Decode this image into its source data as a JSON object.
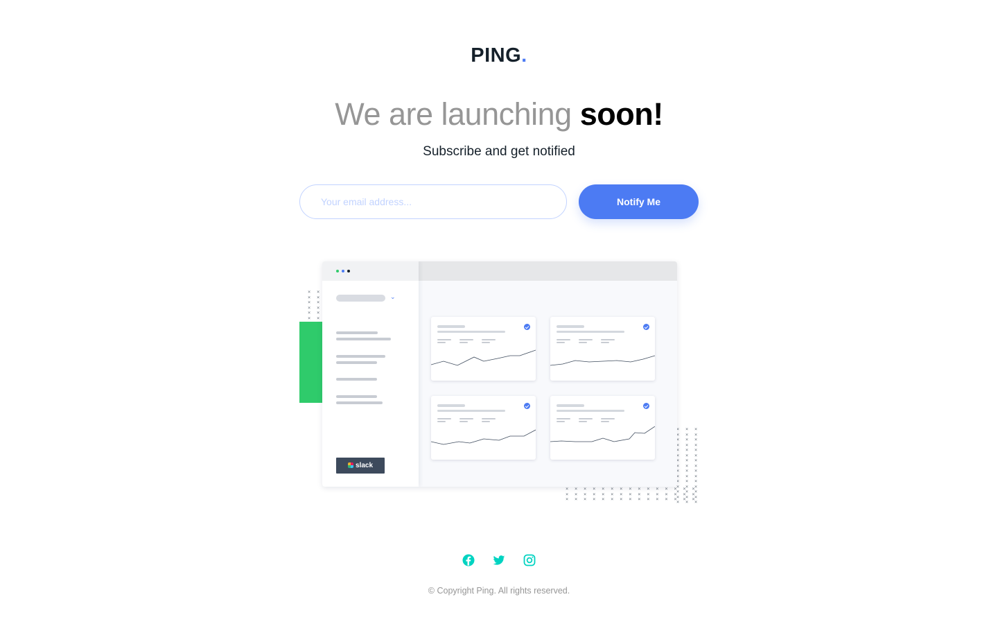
{
  "brand": {
    "name": "PING",
    "dot": "."
  },
  "hero": {
    "headline_light": "We are launching",
    "headline_bold": "soon!",
    "subline": "Subscribe and get notified"
  },
  "form": {
    "email_placeholder": "Your email address...",
    "email_value": "",
    "button_label": "Notify Me"
  },
  "illustration": {
    "badge_label": "slack",
    "window_dot_colors": [
      "#2fcb6b",
      "#4c7bf3",
      "#15202a"
    ]
  },
  "social": [
    {
      "name": "facebook-icon",
      "color": "#00d3c1"
    },
    {
      "name": "twitter-icon",
      "color": "#00d3c1"
    },
    {
      "name": "instagram-icon",
      "color": "#00d3c1"
    }
  ],
  "footer": {
    "copyright": "© Copyright Ping. All rights reserved."
  },
  "colors": {
    "accent": "#4c7bf3",
    "green": "#2fcb6b",
    "social": "#00d3c1",
    "text": "#15202a",
    "muted": "#969696"
  }
}
